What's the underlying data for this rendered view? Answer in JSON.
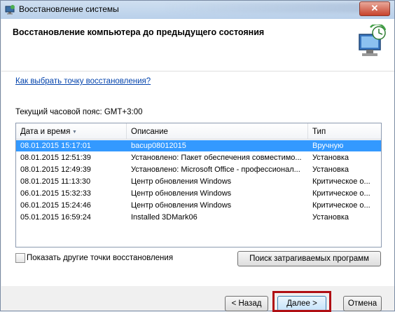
{
  "window": {
    "title": "Восстановление системы",
    "close_label": "✕"
  },
  "header": {
    "title": "Восстановление компьютера до предыдущего состояния"
  },
  "help_link": "Как выбрать точку восстановления?",
  "timezone": "Текущий часовой пояс: GMT+3:00",
  "table": {
    "columns": [
      "Дата и время",
      "Описание",
      "Тип"
    ],
    "rows": [
      {
        "date": "08.01.2015 15:17:01",
        "desc": "bacup08012015",
        "type": "Вручную",
        "selected": true
      },
      {
        "date": "08.01.2015 12:51:39",
        "desc": "Установлено: Пакет обеспечения совместимо...",
        "type": "Установка"
      },
      {
        "date": "08.01.2015 12:49:39",
        "desc": "Установлено: Microsoft Office - профессионал...",
        "type": "Установка"
      },
      {
        "date": "08.01.2015 11:13:30",
        "desc": "Центр обновления Windows",
        "type": "Критическое о..."
      },
      {
        "date": "06.01.2015 15:32:33",
        "desc": "Центр обновления Windows",
        "type": "Критическое о..."
      },
      {
        "date": "06.01.2015 15:24:46",
        "desc": "Центр обновления Windows",
        "type": "Критическое о..."
      },
      {
        "date": "05.01.2015 16:59:24",
        "desc": "Installed 3DMark06",
        "type": "Установка"
      }
    ]
  },
  "show_more_label": "Показать другие точки восстановления",
  "buttons": {
    "search": "Поиск затрагиваемых программ",
    "back": "< Назад",
    "next": "Далее >",
    "cancel": "Отмена"
  },
  "colors": {
    "selection": "#3399ff",
    "highlight": "#b00f14"
  }
}
